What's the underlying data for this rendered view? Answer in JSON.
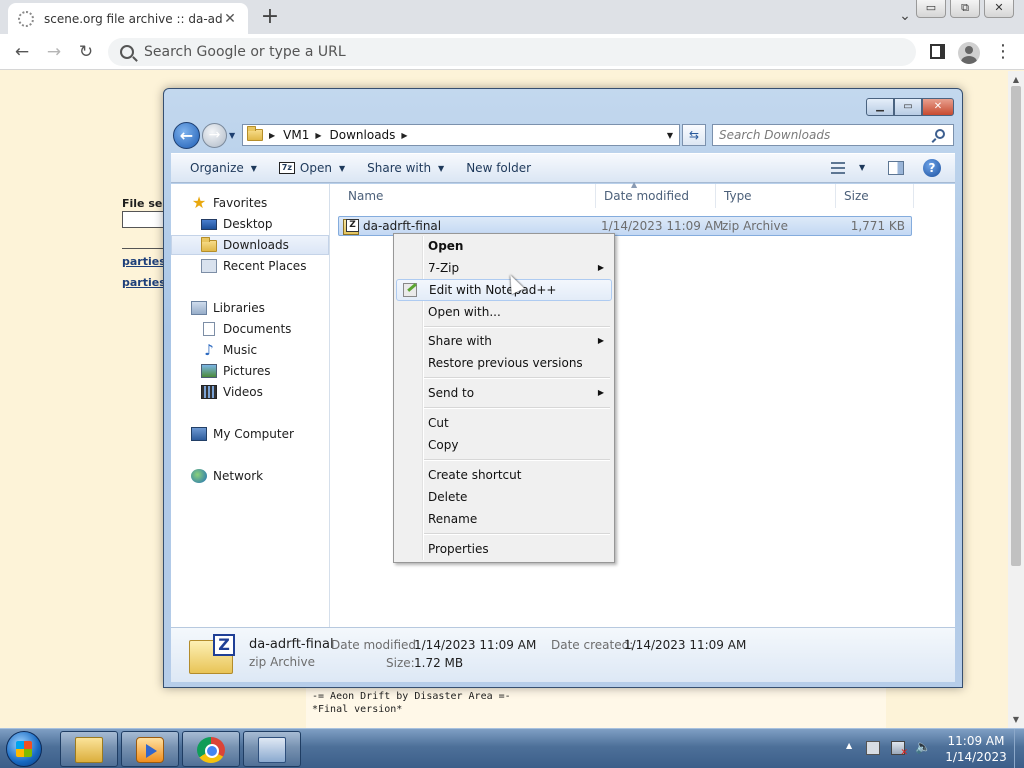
{
  "browser": {
    "tab_title": "scene.org file archive :: da-adrft-final",
    "tab_close": "✕",
    "new_tab": "+",
    "tab_list": "⌄",
    "back": "←",
    "forward": "→",
    "reload": "↻",
    "omnibox_placeholder": "Search Google or type a URL",
    "menu": "⋮",
    "window_minimize": "▭",
    "window_restore": "⧉",
    "window_close": "✕"
  },
  "webpage": {
    "file_search_label": "File sea",
    "links": [
      "parties",
      "parties"
    ],
    "pre_text": "-= Aeon Drift by Disaster Area =-\n*Final version*"
  },
  "explorer": {
    "breadcrumb": [
      "VM1",
      "Downloads"
    ],
    "search_placeholder": "Search Downloads",
    "commands": {
      "organize": "Organize",
      "open": "Open",
      "share_with": "Share with",
      "new_folder": "New folder"
    },
    "nav": {
      "favorites": "Favorites",
      "desktop": "Desktop",
      "downloads": "Downloads",
      "recent_places": "Recent Places",
      "libraries": "Libraries",
      "documents": "Documents",
      "music": "Music",
      "pictures": "Pictures",
      "videos": "Videos",
      "my_computer": "My Computer",
      "network": "Network"
    },
    "columns": {
      "name": "Name",
      "date_modified": "Date modified",
      "type": "Type",
      "size": "Size"
    },
    "file": {
      "name": "da-adrft-final",
      "date_modified": "1/14/2023 11:09 AM",
      "type": "zip Archive",
      "size": "1,771 KB"
    },
    "details": {
      "name": "da-adrft-final",
      "type": "zip Archive",
      "date_modified_label": "Date modified:",
      "date_modified": "1/14/2023 11:09 AM",
      "date_created_label": "Date created:",
      "date_created": "1/14/2023 11:09 AM",
      "size_label": "Size:",
      "size": "1.72 MB"
    }
  },
  "context_menu": {
    "open": "Open",
    "seven_zip": "7-Zip",
    "edit_notepad": "Edit with Notepad++",
    "open_with": "Open with...",
    "share_with": "Share with",
    "restore": "Restore previous versions",
    "send_to": "Send to",
    "cut": "Cut",
    "copy": "Copy",
    "create_shortcut": "Create shortcut",
    "delete": "Delete",
    "rename": "Rename",
    "properties": "Properties"
  },
  "taskbar": {
    "time": "11:09 AM",
    "date": "1/14/2023"
  }
}
